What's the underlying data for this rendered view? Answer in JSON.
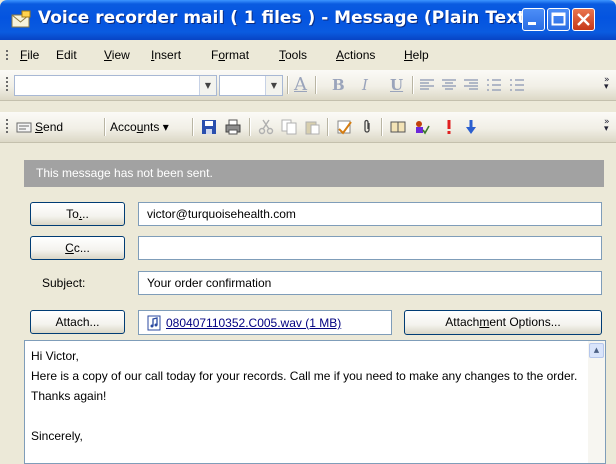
{
  "window": {
    "title": "Voice recorder mail ( 1 files ) - Message (Plain Text)",
    "accent": "#0a5be0"
  },
  "menu": {
    "items": [
      {
        "mnemonic": "F",
        "rest": "ile"
      },
      {
        "mnemonic": "",
        "rest": "Edit"
      },
      {
        "mnemonic": "V",
        "rest": "iew"
      },
      {
        "mnemonic": "I",
        "rest": "nsert"
      },
      {
        "pre": "F",
        "mnemonic": "o",
        "rest": "rmat"
      },
      {
        "mnemonic": "T",
        "rest": "ools"
      },
      {
        "mnemonic": "A",
        "rest": "ctions"
      },
      {
        "mnemonic": "H",
        "rest": "elp"
      }
    ]
  },
  "formatting": {
    "font_name": "",
    "font_size": "",
    "icons": [
      "font-color-icon",
      "bold-icon",
      "italic-icon",
      "underline-icon",
      "align-left-icon",
      "align-center-icon",
      "align-right-icon",
      "bullets-icon",
      "numbering-icon"
    ],
    "bold": "B",
    "italic": "I",
    "underline": "U",
    "font_color": "A"
  },
  "standard": {
    "send_mnemonic": "S",
    "send_rest": "end",
    "accounts_pre": "Acco",
    "accounts_mnemonic": "u",
    "accounts_rest": "nts"
  },
  "notice": "This message has not been sent.",
  "header": {
    "to_button_pre": "To",
    "to_button_mnemonic": ".",
    "to_button_post": "..",
    "cc_button_mnemonic": "C",
    "cc_button_rest": "c...",
    "to_value": "victor@turquoisehealth.com",
    "cc_value": "",
    "subject_label": "Subject:",
    "subject_value": "Your order confirmation",
    "attach_button": "Attach...",
    "attachment": "080407110352.C005.wav (1 MB)",
    "attachment_options_pre": "Attach",
    "attachment_options_mnemonic": "m",
    "attachment_options_rest": "ent Options..."
  },
  "message_body": "Hi Victor,\nHere is a copy of our call today for your records. Call me if you need to make any changes to the order. Thanks again!\n\nSincerely,"
}
